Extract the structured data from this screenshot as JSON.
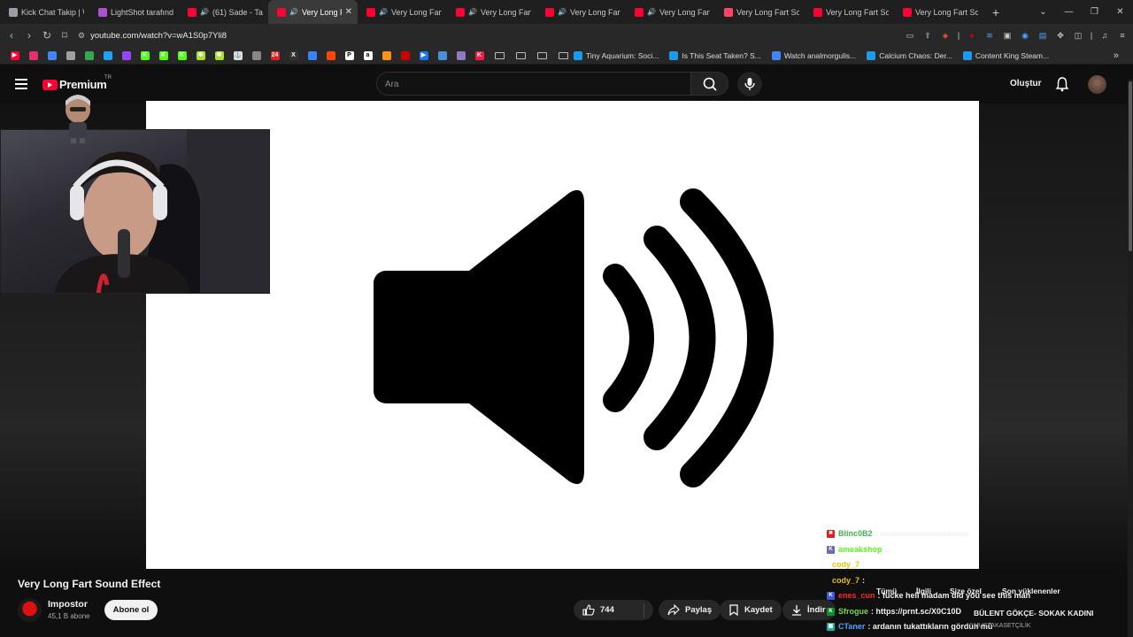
{
  "browser": {
    "tabs": [
      {
        "title": "Kick Chat Takip | W",
        "fav_color": "#9aa0a6",
        "audio": false,
        "active": false
      },
      {
        "title": "LightShot tarafından",
        "fav_color": "#b04fd1",
        "audio": false,
        "active": false
      },
      {
        "title": "(61) Sade - Tar",
        "fav_color": "#ff0033",
        "audio": true,
        "active": false
      },
      {
        "title": "Very Long F",
        "fav_color": "#ff0033",
        "audio": true,
        "active": true
      },
      {
        "title": "Very Long Fart",
        "fav_color": "#ff0033",
        "audio": true,
        "active": false
      },
      {
        "title": "Very Long Fart",
        "fav_color": "#ff0033",
        "audio": true,
        "active": false
      },
      {
        "title": "Very Long Fart",
        "fav_color": "#ff0033",
        "audio": true,
        "active": false
      },
      {
        "title": "Very Long Fart",
        "fav_color": "#ff0033",
        "audio": true,
        "active": false
      },
      {
        "title": "Very Long Fart Sou",
        "fav_color": "#ff4466",
        "audio": false,
        "active": false
      },
      {
        "title": "Very Long Fart Sou",
        "fav_color": "#ff0033",
        "audio": false,
        "active": false
      },
      {
        "title": "Very Long Fart Sou",
        "fav_color": "#ff0033",
        "audio": false,
        "active": false
      }
    ],
    "new_tab": "+",
    "url": "youtube.com/watch?v=wA1S0p7Yli8",
    "bookmarks_icons": [
      {
        "color": "#ff0033",
        "glyph": "▶"
      },
      {
        "color": "#e1306c",
        "glyph": ""
      },
      {
        "color": "#4285f4",
        "glyph": ""
      },
      {
        "color": "#9aa0a6",
        "glyph": ""
      },
      {
        "color": "#34a853",
        "glyph": ""
      },
      {
        "color": "#1da1f2",
        "glyph": ""
      },
      {
        "color": "#9146ff",
        "glyph": ""
      },
      {
        "color": "#53fc18",
        "glyph": "K"
      },
      {
        "color": "#53fc18",
        "glyph": "K"
      },
      {
        "color": "#53fc18",
        "glyph": "K"
      },
      {
        "color": "#a6e22e",
        "glyph": "✱"
      },
      {
        "color": "#a6e22e",
        "glyph": "✱"
      },
      {
        "color": "#dddddd",
        "glyph": "⚓"
      },
      {
        "color": "#888888",
        "glyph": ""
      },
      {
        "color": "#e02020",
        "glyph": "24"
      },
      {
        "color": "#333333",
        "glyph": "X"
      },
      {
        "color": "#3b82f6",
        "glyph": ""
      },
      {
        "color": "#ff4500",
        "glyph": ""
      },
      {
        "color": "#ffffff",
        "glyph": "P"
      },
      {
        "color": "#ffffff",
        "glyph": "a"
      },
      {
        "color": "#f7931a",
        "glyph": ""
      },
      {
        "color": "#cc0000",
        "glyph": ""
      },
      {
        "color": "#1877f2",
        "glyph": "▶"
      },
      {
        "color": "#4a90d9",
        "glyph": ""
      },
      {
        "color": "#8e7cc3",
        "glyph": ""
      },
      {
        "color": "#ff1744",
        "glyph": "K"
      }
    ],
    "bookmarks_named": [
      {
        "label": "Tiny Aquarium: Soci...",
        "color": "#1b9aee"
      },
      {
        "label": "Is This Seat Taken? S...",
        "color": "#1b9aee"
      },
      {
        "label": "Watch analmorgulis...",
        "color": "#4285f4"
      },
      {
        "label": "Calcium Chaos: Der...",
        "color": "#1b9aee"
      },
      {
        "label": "Content King Steam...",
        "color": "#1b9aee"
      }
    ],
    "more_bookmarks": "»"
  },
  "youtube": {
    "logo_word": "Premium",
    "region": "TR",
    "search_placeholder": "Ara",
    "create_label": "Oluştur"
  },
  "video": {
    "title": "Very Long Fart Sound Effect",
    "channel": "Impostor",
    "subscribers": "45,1 B abone",
    "subscribe_label": "Abone ol",
    "likes": "744",
    "share_label": "Paylaş",
    "save_label": "Kaydet",
    "download_label": "İndir"
  },
  "recommend_chips": [
    "Tümü",
    "İlgili",
    "Size özel",
    "Son yüklenenler"
  ],
  "chat": [
    {
      "user": "Blinc0B2",
      "msg": ": aaaaaaaaaaaaaaaaaaaa",
      "user_color": "#3fb24f",
      "badge": "#e02020",
      "badge_glyph": "✖"
    },
    {
      "user": "ameakshop",
      "msg": ":",
      "user_color": "#53fc18",
      "badge": "#6b6bb0",
      "badge_glyph": "K"
    },
    {
      "user": "cody_7",
      "msg": ":",
      "user_color": "#e8c100",
      "badge": "",
      "badge_glyph": ""
    },
    {
      "user": "cody_7",
      "msg": ":",
      "user_color": "#e8c100",
      "badge": "",
      "badge_glyph": ""
    },
    {
      "user": "enes_cun",
      "msg": ": fucke hell madam did you see this man",
      "user_color": "#ff2a2a",
      "badge": "#3a58d8",
      "badge_glyph": "K"
    },
    {
      "user": "Sfrogue",
      "msg": ": https://prnt.sc/X0C10D",
      "user_color": "#7bd651",
      "badge": "#0a8f2f",
      "badge_glyph": "K"
    },
    {
      "user": "CTaner",
      "msg": ": ardanın tukattıkların gördün mü",
      "user_color": "#4aa3ff",
      "badge": "#18b3a3",
      "badge_glyph": "▣"
    }
  ],
  "overlay_track": {
    "title": "BÜLENT GÖKÇE- SOKAK KADINI",
    "subtitle": "MUSTAKASETÇİLİK"
  }
}
